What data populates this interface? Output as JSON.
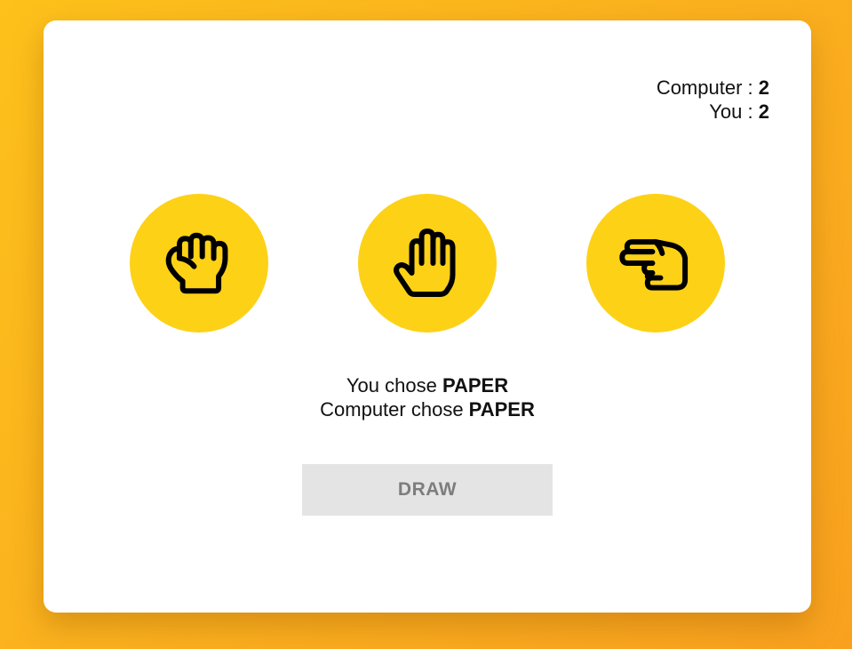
{
  "score": {
    "computer_label": "Computer : ",
    "computer_value": "2",
    "you_label": "You : ",
    "you_value": "2"
  },
  "choices": [
    {
      "name": "rock",
      "icon": "fist-icon"
    },
    {
      "name": "paper",
      "icon": "open-hand-icon"
    },
    {
      "name": "scissors",
      "icon": "two-fingers-icon"
    }
  ],
  "result": {
    "you_chose_label": "You chose ",
    "you_chose_value": "PAPER",
    "computer_chose_label": "Computer chose ",
    "computer_chose_value": "PAPER"
  },
  "action_button": {
    "label": "DRAW"
  },
  "colors": {
    "background": "#fbb21e",
    "choice_circle": "#fdd116",
    "button_bg": "#e4e4e4",
    "button_text": "#7d7d7d"
  }
}
